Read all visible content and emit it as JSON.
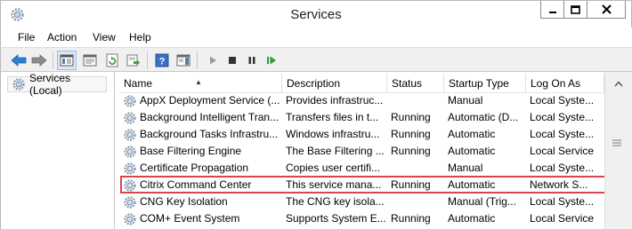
{
  "window": {
    "title": "Services"
  },
  "menu": {
    "items": [
      "File",
      "Action",
      "View",
      "Help"
    ]
  },
  "toolbar": {
    "icons": [
      "back-arrow-icon",
      "forward-arrow-icon",
      "show-hide-console-tree-icon",
      "properties-icon",
      "refresh-icon",
      "export-list-icon",
      "help-icon",
      "show-action-pane-icon",
      "start-service-icon",
      "stop-service-icon",
      "pause-service-icon",
      "restart-service-icon"
    ]
  },
  "tree": {
    "root_label": "Services (Local)"
  },
  "columns": {
    "name": "Name",
    "description": "Description",
    "status": "Status",
    "startup_type": "Startup Type",
    "log_on_as": "Log On As"
  },
  "rows": [
    {
      "name": "AppX Deployment Service (...",
      "description": "Provides infrastruc...",
      "status": "",
      "startup": "Manual",
      "logon": "Local Syste..."
    },
    {
      "name": "Background Intelligent Tran...",
      "description": "Transfers files in t...",
      "status": "Running",
      "startup": "Automatic (D...",
      "logon": "Local Syste..."
    },
    {
      "name": "Background Tasks Infrastru...",
      "description": "Windows infrastru...",
      "status": "Running",
      "startup": "Automatic",
      "logon": "Local Syste..."
    },
    {
      "name": "Base Filtering Engine",
      "description": "The Base Filtering ...",
      "status": "Running",
      "startup": "Automatic",
      "logon": "Local Service"
    },
    {
      "name": "Certificate Propagation",
      "description": "Copies user certifi...",
      "status": "",
      "startup": "Manual",
      "logon": "Local Syste..."
    },
    {
      "name": "Citrix Command Center",
      "description": "This service mana...",
      "status": "Running",
      "startup": "Automatic",
      "logon": "Network S..."
    },
    {
      "name": "CNG Key Isolation",
      "description": "The CNG key isola...",
      "status": "",
      "startup": "Manual (Trig...",
      "logon": "Local Syste..."
    },
    {
      "name": "COM+ Event System",
      "description": "Supports System E...",
      "status": "Running",
      "startup": "Automatic",
      "logon": "Local Service"
    }
  ],
  "colors": {
    "highlight": "#d9454a",
    "toolbar_bg": "#f0f0f0"
  }
}
